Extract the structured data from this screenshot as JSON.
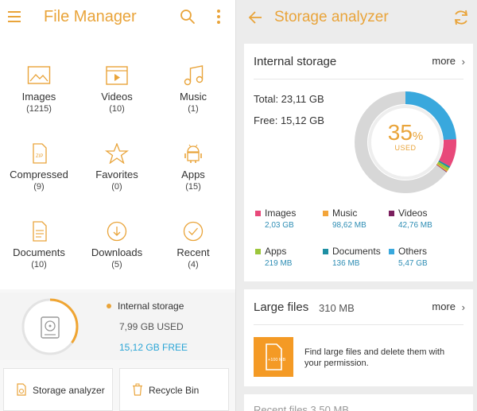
{
  "left": {
    "title": "File Manager",
    "categories": [
      {
        "label": "Images",
        "count": "(1215)"
      },
      {
        "label": "Videos",
        "count": "(10)"
      },
      {
        "label": "Music",
        "count": "(1)"
      },
      {
        "label": "Compressed",
        "count": "(9)"
      },
      {
        "label": "Favorites",
        "count": "(0)"
      },
      {
        "label": "Apps",
        "count": "(15)"
      },
      {
        "label": "Documents",
        "count": "(10)"
      },
      {
        "label": "Downloads",
        "count": "(5)"
      },
      {
        "label": "Recent",
        "count": "(4)"
      }
    ],
    "storage": {
      "label": "Internal storage",
      "used": "7,99 GB USED",
      "free": "15,12 GB FREE",
      "used_fraction": 0.35
    },
    "buttons": {
      "storage_analyzer": "Storage analyzer",
      "recycle_bin": "Recycle Bin"
    }
  },
  "right": {
    "title": "Storage analyzer",
    "internal": {
      "heading": "Internal storage",
      "more": "more",
      "total": "Total: 23,11 GB",
      "free": "Free: 15,12 GB",
      "percent": "35",
      "percent_sign": "%",
      "used_label": "USED",
      "legend": [
        {
          "name": "Images",
          "value": "2,03 GB",
          "color": "#e8497a"
        },
        {
          "name": "Music",
          "value": "98,62 MB",
          "color": "#f3a53a"
        },
        {
          "name": "Videos",
          "value": "42,76 MB",
          "color": "#7b1f5e"
        },
        {
          "name": "Apps",
          "value": "219 MB",
          "color": "#9cc63b"
        },
        {
          "name": "Documents",
          "value": "136 MB",
          "color": "#1e8fa3"
        },
        {
          "name": "Others",
          "value": "5,47 GB",
          "color": "#39a8dd"
        }
      ]
    },
    "large_files": {
      "heading": "Large files",
      "size": "310 MB",
      "more": "more",
      "icon_text": "+100 MB",
      "text": "Find large files and delete them with your permission."
    },
    "recent": {
      "heading": "Recent files  3,50 MB"
    }
  }
}
